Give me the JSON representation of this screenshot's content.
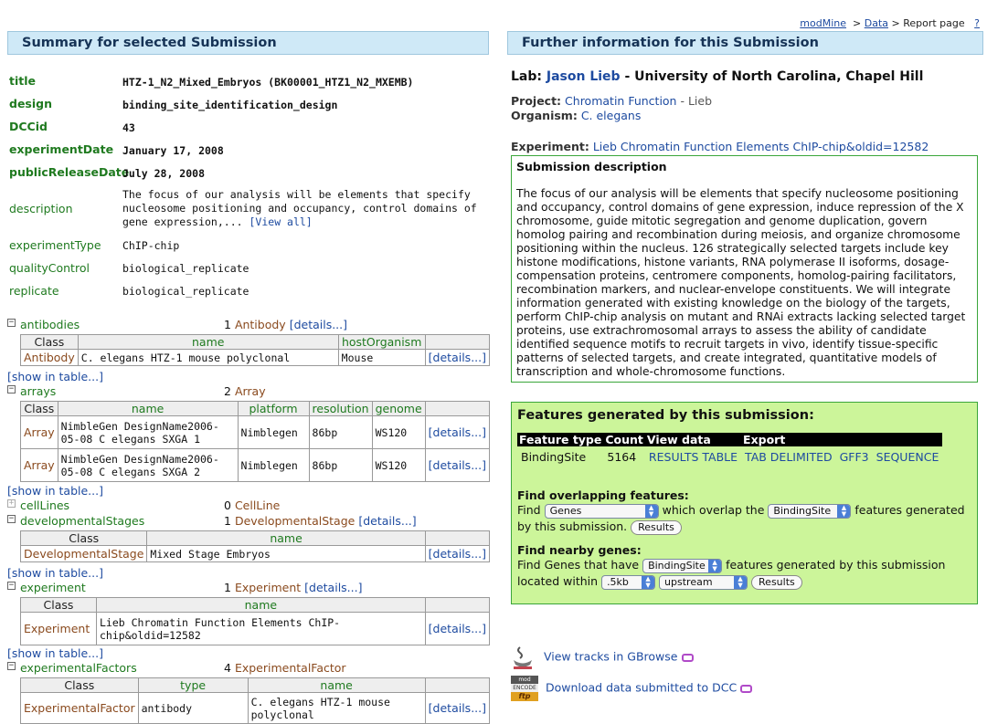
{
  "breadcrumb": {
    "home": "modMine",
    "data": "Data",
    "current": "> Report page",
    "help": "?",
    "sep": ">"
  },
  "left_header": "Summary for selected Submission",
  "right_header": "Further information for this Submission",
  "summary": [
    {
      "key": "title",
      "value": "HTZ-1_N2_Mixed_Embryos (BK00001_HTZ1_N2_MXEMB)"
    },
    {
      "key": "design",
      "value": "binding_site_identification_design"
    },
    {
      "key": "DCCid",
      "value": "43"
    },
    {
      "key": "experimentDate",
      "value": "January 17, 2008"
    },
    {
      "key": "publicReleaseDate",
      "value": "July 28, 2008"
    },
    {
      "key": "description",
      "value": "The focus of our analysis will be elements that specify nucleosome positioning and occupancy, control domains of gene expression,...",
      "view_all": "[View all]"
    },
    {
      "key": "experimentType",
      "value": "ChIP-chip"
    },
    {
      "key": "qualityControl",
      "value": "biological_replicate"
    },
    {
      "key": "replicate",
      "value": "biological_replicate"
    }
  ],
  "collections": {
    "antibodies": {
      "name": "antibodies",
      "count": "1",
      "type": "Antibody",
      "details": "[details...]",
      "headers": [
        "Class",
        "name",
        "hostOrganism"
      ],
      "rows": [
        {
          "cls": "Antibody",
          "name": "C. elegans HTZ-1 mouse polyclonal",
          "host": "Mouse",
          "details": "[details...]"
        }
      ]
    },
    "arrays": {
      "name": "arrays",
      "count": "2",
      "type": "Array",
      "headers": [
        "Class",
        "name",
        "platform",
        "resolution",
        "genome"
      ],
      "rows": [
        {
          "cls": "Array",
          "name": "NimbleGen DesignName2006-05-08 C elegans SXGA 1",
          "platform": "Nimblegen",
          "resolution": "86bp",
          "genome": "WS120",
          "details": "[details...]"
        },
        {
          "cls": "Array",
          "name": "NimbleGen DesignName2006-05-08 C elegans SXGA 2",
          "platform": "Nimblegen",
          "resolution": "86bp",
          "genome": "WS120",
          "details": "[details...]"
        }
      ]
    },
    "cellLines": {
      "name": "cellLines",
      "count": "0",
      "type": "CellLine"
    },
    "developmentalStages": {
      "name": "developmentalStages",
      "count": "1",
      "type": "DevelopmentalStage",
      "details": "[details...]",
      "headers": [
        "Class",
        "name"
      ],
      "rows": [
        {
          "cls": "DevelopmentalStage",
          "name": "Mixed Stage Embryos",
          "details": "[details...]"
        }
      ]
    },
    "experiment": {
      "name": "experiment",
      "count": "1",
      "type": "Experiment",
      "details": "[details...]",
      "headers": [
        "Class",
        "name"
      ],
      "rows": [
        {
          "cls": "Experiment",
          "name": "Lieb Chromatin Function Elements ChIP-chip&oldid=12582",
          "details": "[details...]"
        }
      ]
    },
    "experimentalFactors": {
      "name": "experimentalFactors",
      "count": "4",
      "type": "ExperimentalFactor",
      "headers": [
        "Class",
        "type",
        "name"
      ],
      "rows": [
        {
          "cls": "ExperimentalFactor",
          "type": "antibody",
          "name": "C. elegans HTZ-1 mouse polyclonal",
          "details": "[details...]"
        }
      ]
    }
  },
  "show_in_table": "[show in table...]",
  "toggle_minus": "−",
  "toggle_plus": "+",
  "lab": {
    "label": "Lab:",
    "name": "Jason Lieb",
    "institution": "- University of North Carolina, Chapel Hill"
  },
  "project": {
    "label": "Project:",
    "name": "Chromatin Function",
    "pi": "- Lieb"
  },
  "organism": {
    "label": "Organism:",
    "name": "C. elegans"
  },
  "experiment_line": {
    "label": "Experiment:",
    "name": "Lieb Chromatin Function Elements ChIP-chip&oldid=12582"
  },
  "description_box": {
    "title": "Submission description",
    "text": "The focus of our analysis will be elements that specify nucleosome positioning and occupancy, control domains of gene expression, induce repression of the X chromosome, guide mitotic segregation and genome duplication, govern homolog pairing and recombination during meiosis, and organize chromosome positioning within the nucleus. 126 strategically selected targets include key histone modifications, histone variants, RNA polymerase II isoforms, dosage-compensation proteins, centromere components, homolog-pairing facilitators, recombination markers, and nuclear-envelope constituents. We will integrate information generated with existing knowledge on the biology of the targets, perform ChIP-chip analysis on mutant and RNAi extracts lacking selected target proteins, use extrachromosomal arrays to assess the ability of candidate identified sequence motifs to recruit targets in vivo, identify tissue-specific patterns of selected targets, and create integrated, quantitative models of transcription and whole-chromosome functions."
  },
  "features": {
    "title": "Features generated by this submission:",
    "headers": [
      "Feature type",
      "Count",
      "View data",
      "Export"
    ],
    "row": {
      "type": "BindingSite",
      "count": "5164",
      "view": "RESULTS TABLE",
      "export_tab": "TAB DELIMITED",
      "export_gff": "GFF3",
      "export_seq": "SEQUENCE"
    },
    "overlap_title": "Find overlapping features:",
    "overlap_find": "Find",
    "overlap_select1": "Genes",
    "overlap_mid": "which overlap the",
    "overlap_select2": "BindingSite",
    "overlap_end": "features generated by this submission.",
    "overlap_button": "Results",
    "nearby_title": "Find nearby genes:",
    "nearby_text1": "Find Genes that have",
    "nearby_select1": "BindingSite",
    "nearby_text2": "features generated by this submission located within",
    "nearby_select2": ".5kb",
    "nearby_select3": "upstream",
    "nearby_button": "Results"
  },
  "gbrowse_link": "View tracks in GBrowse",
  "dcc_link": "Download data submitted to DCC",
  "dcc_icon_text": {
    "top": "mod",
    "mid": "ENCODE",
    "bottom": "ftp"
  }
}
